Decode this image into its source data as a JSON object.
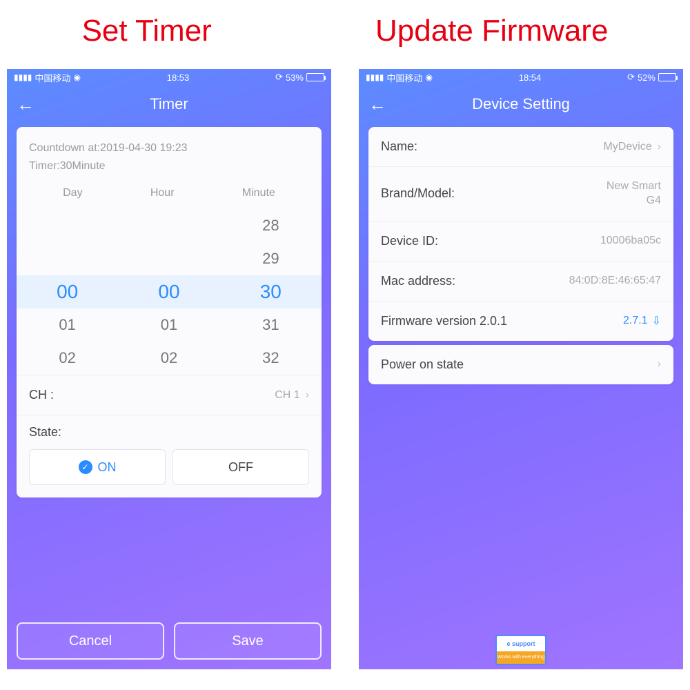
{
  "titles": {
    "left": "Set Timer",
    "right": "Update Firmware"
  },
  "left": {
    "status": {
      "carrier": "中国移动",
      "time": "18:53",
      "battery_pct": "53%",
      "battery_fill": 53
    },
    "nav_title": "Timer",
    "countdown_line": "Countdown at:2019-04-30 19:23",
    "timer_line": "Timer:30Minute",
    "picker_labels": {
      "day": "Day",
      "hour": "Hour",
      "minute": "Minute"
    },
    "picker": {
      "day": {
        "above2": "",
        "above1": "",
        "sel": "00",
        "below1": "01",
        "below2": "02"
      },
      "hour": {
        "above2": "",
        "above1": "",
        "sel": "00",
        "below1": "01",
        "below2": "02"
      },
      "minute": {
        "above2": "28",
        "above1": "29",
        "sel": "30",
        "below1": "31",
        "below2": "32"
      }
    },
    "ch_label": "CH :",
    "ch_value": "CH 1",
    "state_label": "State:",
    "on_label": "ON",
    "off_label": "OFF",
    "cancel": "Cancel",
    "save": "Save"
  },
  "right": {
    "status": {
      "carrier": "中国移动",
      "time": "18:54",
      "battery_pct": "52%",
      "battery_fill": 52
    },
    "nav_title": "Device Setting",
    "rows": {
      "name_label": "Name:",
      "name_value": "MyDevice",
      "brand_label": "Brand/Model:",
      "brand_value_l1": "New Smart",
      "brand_value_l2": "G4",
      "deviceid_label": "Device ID:",
      "deviceid_value": "10006ba05c",
      "mac_label": "Mac address:",
      "mac_value": "84:0D:8E:46:65:47",
      "fw_label": "Firmware version 2.0.1",
      "fw_value": "2.7.1",
      "power_label": "Power on state"
    },
    "badge": {
      "top": "e support",
      "bottom": "Works with everything"
    }
  }
}
